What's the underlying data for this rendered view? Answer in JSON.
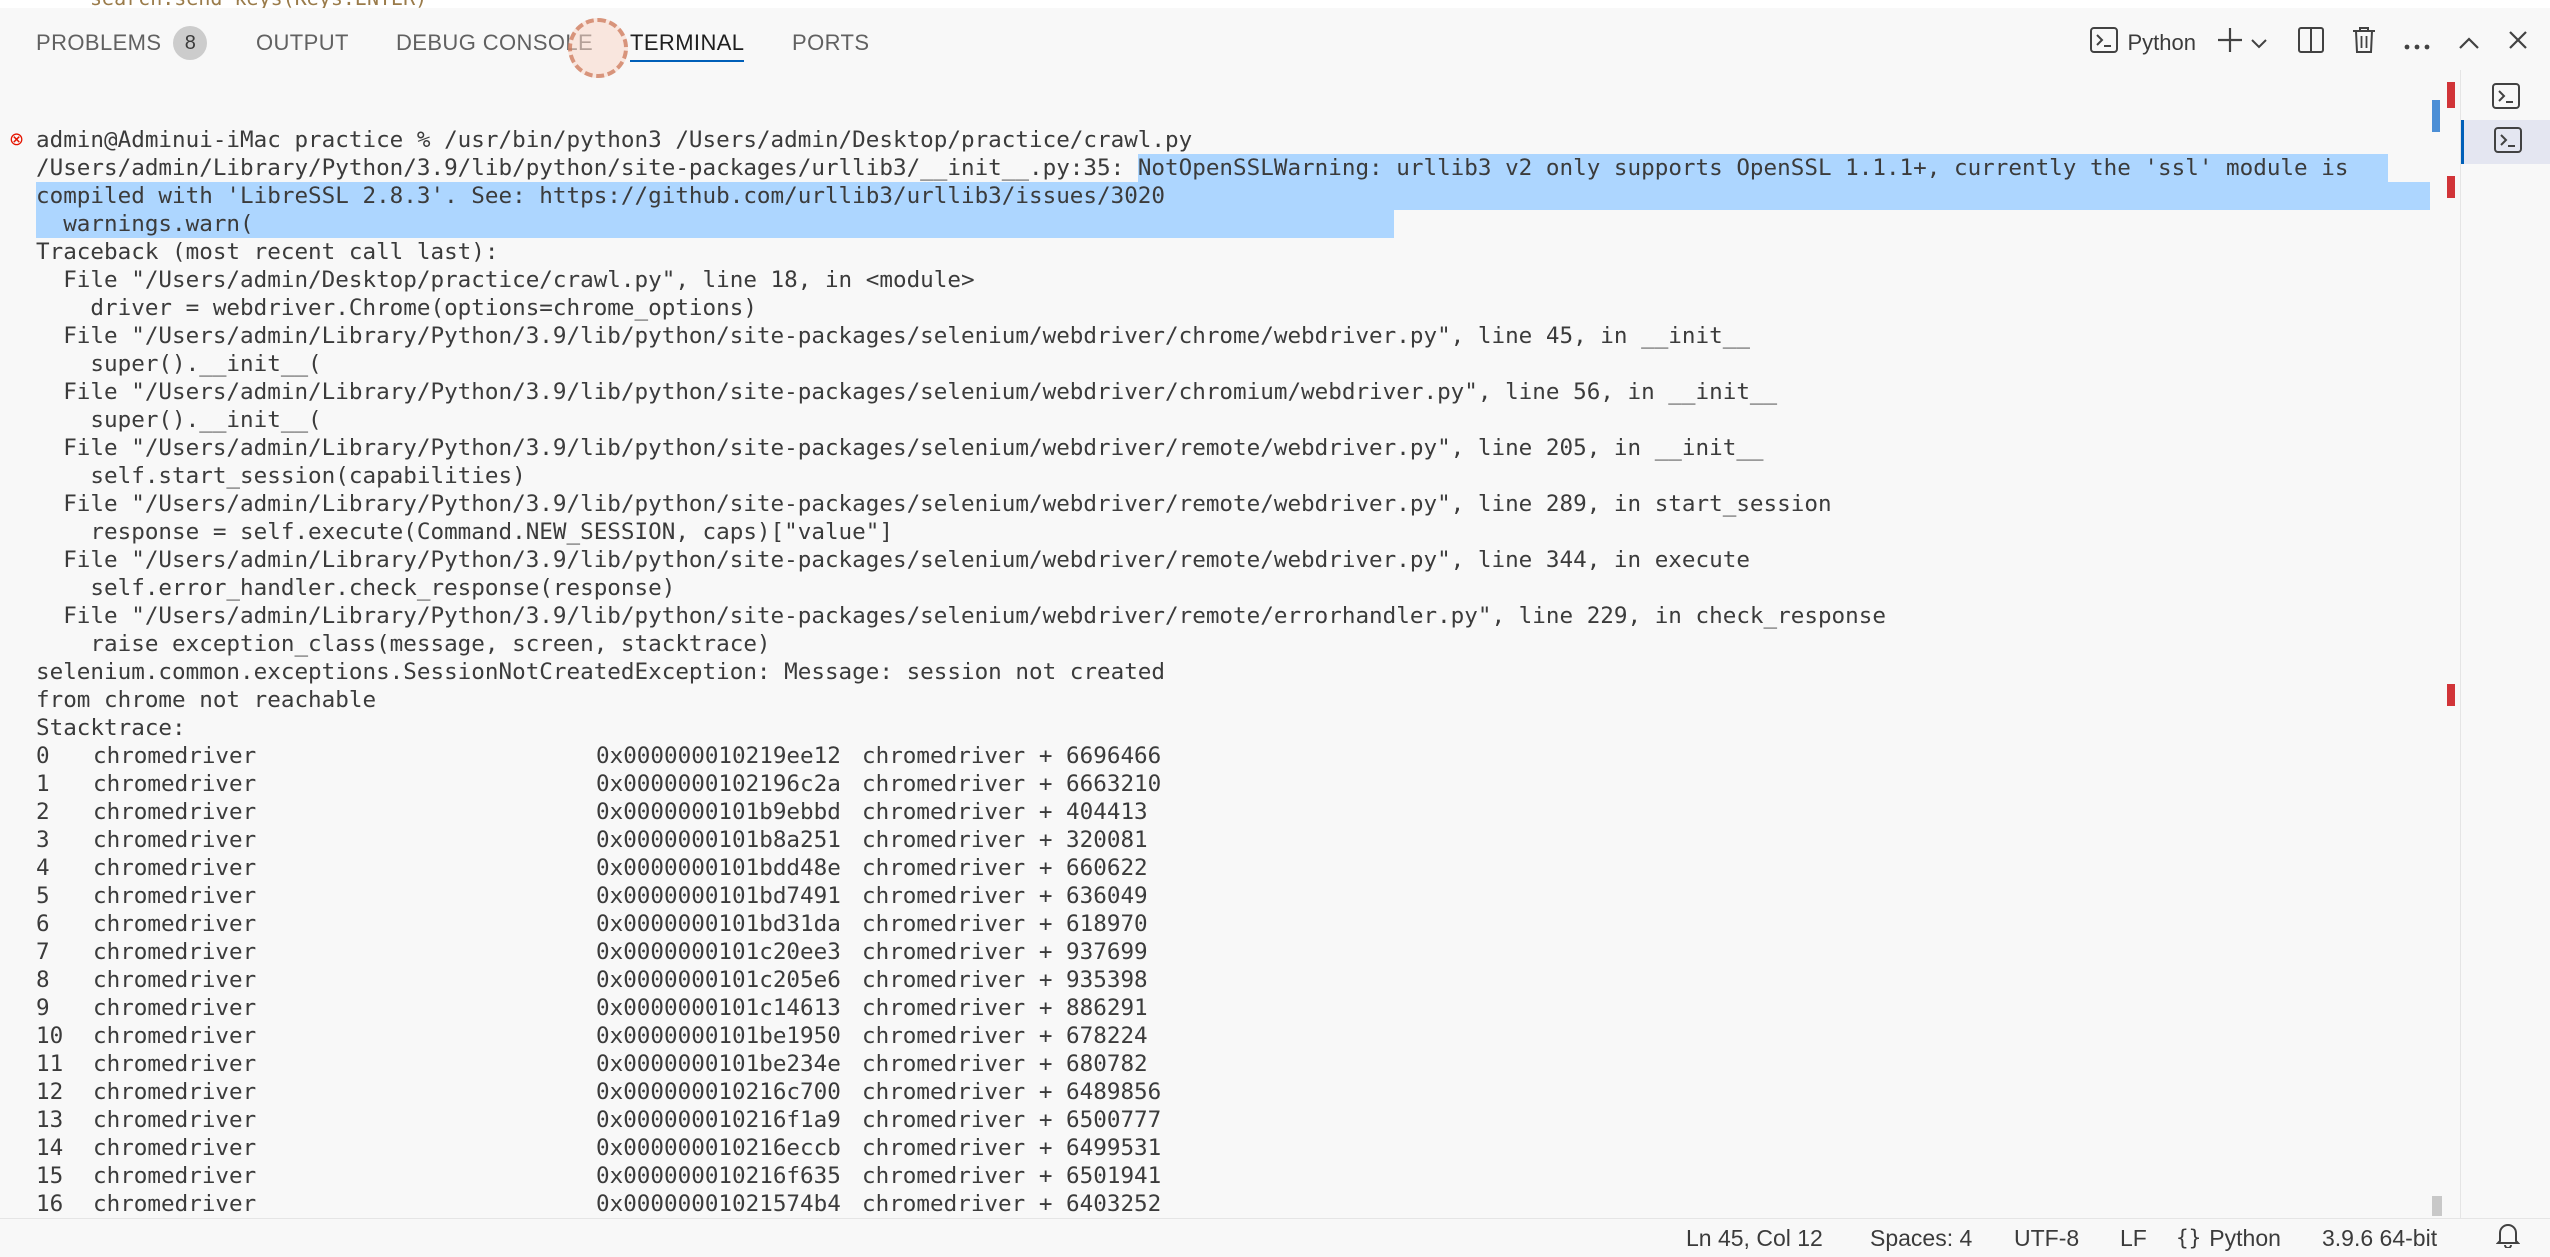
{
  "editor_peek": "search.send_keys(Keys.ENTER)",
  "panel": {
    "tabs": [
      {
        "label": "PROBLEMS",
        "badge": "8"
      },
      {
        "label": "OUTPUT"
      },
      {
        "label": "DEBUG CONSOLE"
      },
      {
        "label": "TERMINAL"
      },
      {
        "label": "PORTS"
      }
    ],
    "active_tab": "TERMINAL",
    "shell_label": "Python",
    "tool_icons": [
      "terminal-icon",
      "plus-icon",
      "chevron-down-icon",
      "split-icon",
      "trash-icon",
      "ellipsis-icon",
      "chevron-up-icon",
      "close-icon"
    ]
  },
  "terminal": {
    "lines": [
      "admin@Adminui-iMac practice % /usr/bin/python3 /Users/admin/Desktop/practice/crawl.py",
      "/Users/admin/Library/Python/3.9/lib/python/site-packages/urllib3/__init__.py:35: ",
      "NotOpenSSLWarning: urllib3 v2 only supports OpenSSL 1.1.1+, currently the 'ssl' module is",
      "compiled with 'LibreSSL 2.8.3'. See: https://github.com/urllib3/urllib3/issues/3020",
      "  warnings.warn(",
      "Traceback (most recent call last):",
      "  File \"/Users/admin/Desktop/practice/crawl.py\", line 18, in <module>",
      "    driver = webdriver.Chrome(options=chrome_options)",
      "  File \"/Users/admin/Library/Python/3.9/lib/python/site-packages/selenium/webdriver/chrome/webdriver.py\", line 45, in __init__",
      "    super().__init__(",
      "  File \"/Users/admin/Library/Python/3.9/lib/python/site-packages/selenium/webdriver/chromium/webdriver.py\", line 56, in __init__",
      "    super().__init__(",
      "  File \"/Users/admin/Library/Python/3.9/lib/python/site-packages/selenium/webdriver/remote/webdriver.py\", line 205, in __init__",
      "    self.start_session(capabilities)",
      "  File \"/Users/admin/Library/Python/3.9/lib/python/site-packages/selenium/webdriver/remote/webdriver.py\", line 289, in start_session",
      "    response = self.execute(Command.NEW_SESSION, caps)[\"value\"]",
      "  File \"/Users/admin/Library/Python/3.9/lib/python/site-packages/selenium/webdriver/remote/webdriver.py\", line 344, in execute",
      "    self.error_handler.check_response(response)",
      "  File \"/Users/admin/Library/Python/3.9/lib/python/site-packages/selenium/webdriver/remote/errorhandler.py\", line 229, in check_response",
      "    raise exception_class(message, screen, stacktrace)",
      "selenium.common.exceptions.SessionNotCreatedException: Message: session not created",
      "from chrome not reachable",
      "Stacktrace:"
    ],
    "stacktrace": [
      {
        "idx": "0",
        "module": "chromedriver",
        "addr": "0x000000010219ee12",
        "sym": "chromedriver + 6696466"
      },
      {
        "idx": "1",
        "module": "chromedriver",
        "addr": "0x00000001021 96c2a",
        "sym": "chromedriver + 6663210"
      },
      {
        "idx": "2",
        "module": "chromedriver",
        "addr": "0x0000000101b9ebbd",
        "sym": "chromedriver + 404413"
      },
      {
        "idx": "3",
        "module": "chromedriver",
        "addr": "0x0000000101b8a251",
        "sym": "chromedriver + 320081"
      },
      {
        "idx": "4",
        "module": "chromedriver",
        "addr": "0x0000000101bdd48e",
        "sym": "chromedriver + 660622"
      },
      {
        "idx": "5",
        "module": "chromedriver",
        "addr": "0x0000000101bd7491",
        "sym": "chromedriver + 636049"
      },
      {
        "idx": "6",
        "module": "chromedriver",
        "addr": "0x0000000101bd31da",
        "sym": "chromedriver + 618970"
      },
      {
        "idx": "7",
        "module": "chromedriver",
        "addr": "0x0000000101c20ee3",
        "sym": "chromedriver + 937699"
      },
      {
        "idx": "8",
        "module": "chromedriver",
        "addr": "0x0000000101c205e6",
        "sym": "chromedriver + 935398"
      },
      {
        "idx": "9",
        "module": "chromedriver",
        "addr": "0x0000000101c14613",
        "sym": "chromedriver + 886291"
      },
      {
        "idx": "10",
        "module": "chromedriver",
        "addr": "0x0000000101be1950",
        "sym": "chromedriver + 678224"
      },
      {
        "idx": "11",
        "module": "chromedriver",
        "addr": "0x0000000101be234e",
        "sym": "chromedriver + 680782"
      },
      {
        "idx": "12",
        "module": "chromedriver",
        "addr": "0x000000010216c700",
        "sym": "chromedriver + 6489856"
      },
      {
        "idx": "13",
        "module": "chromedriver",
        "addr": "0x000000010216f1a9",
        "sym": "chromedriver + 6500777"
      },
      {
        "idx": "14",
        "module": "chromedriver",
        "addr": "0x000000010216eccb",
        "sym": "chromedriver + 6499531"
      },
      {
        "idx": "15",
        "module": "chromedriver",
        "addr": "0x000000010216f635",
        "sym": "chromedriver + 6501941"
      },
      {
        "idx": "16",
        "module": "chromedriver",
        "addr": "0x00000001021574b4",
        "sym": "chromedriver + 6403252"
      }
    ]
  },
  "statusbar": {
    "cursor": "Ln 45, Col 12",
    "indent": "Spaces: 4",
    "encoding": "UTF-8",
    "eol": "LF",
    "language": "Python",
    "interpreter": "3.9.6 64-bit"
  },
  "colors": {
    "accent": "#005fb8",
    "selection": "#add6ff",
    "error": "#e51400"
  }
}
